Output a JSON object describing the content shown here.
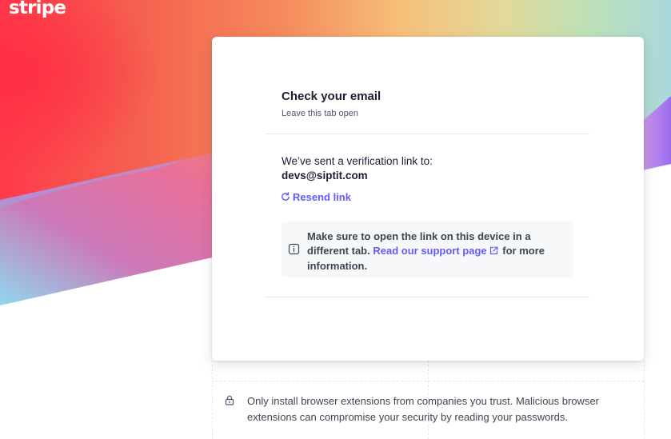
{
  "brand": {
    "logo_text": "stripe"
  },
  "card": {
    "title": "Check your email",
    "subtitle": "Leave this tab open",
    "sent_label": "We’ve sent a verification link to:",
    "email": "devs@siptit.com",
    "resend_label": "Resend link",
    "notice": {
      "text_before": "Make sure to open the link on this device in a different tab.",
      "link_label": "Read our support page",
      "text_after": "for more information."
    }
  },
  "footer": {
    "security_tip": "Only install browser extensions from companies you trust. Malicious browser extensions can compromise your security by reading your passwords."
  },
  "icons": {
    "resend": "refresh-icon",
    "notice": "info-icon",
    "external": "external-link-icon",
    "security": "lock-icon"
  },
  "colors": {
    "accent": "#635bff",
    "text": "#1a1f36",
    "muted": "#4f566b",
    "notice_bg": "#f6f8fa"
  }
}
